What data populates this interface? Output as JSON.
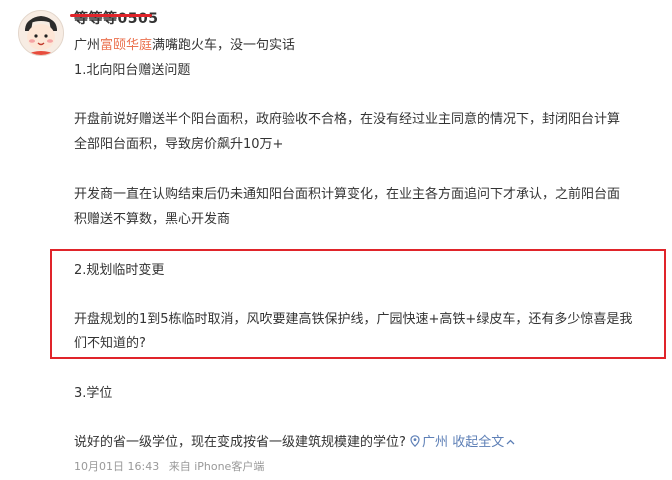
{
  "user": {
    "name": "等等等0505"
  },
  "post": {
    "intro_prefix": "广州",
    "intro_link": "富颐华庭",
    "intro_suffix": "满嘴跑火车，没一句实话",
    "section1_title": "1.北向阳台赠送问题",
    "para1_line1": "开盘前说好赠送半个阳台面积，政府验收不合格，在没有经过业主同意的情况下，封闭阳台计算",
    "para1_line2": "全部阳台面积，导致房价飙升10万+",
    "para2_line1": "开发商一直在认购结束后仍未通知阳台面积计算变化，在业主各方面追问下才承认，之前阳台面",
    "para2_line2": "积赠送不算数，黑心开发商",
    "section2_title": "2.规划临时变更",
    "para3_line1": "开盘规划的1到5栋临时取消，风吹要建高铁保护线，广园快速+高铁+绿皮车，还有多少惊喜是我",
    "para3_line2": "们不知道的?",
    "section3_title": "3.学位",
    "para4": "说好的省一级学位，现在变成按省一级建筑规模建的学位?",
    "location": "广州",
    "collapse_label": "收起全文"
  },
  "meta": {
    "date": "10月01日 16:43",
    "source": "来自 iPhone客户端"
  },
  "colors": {
    "highlight_border": "#e0242a",
    "link_orange": "#eb7350",
    "link_blue": "#5d7fb6"
  }
}
